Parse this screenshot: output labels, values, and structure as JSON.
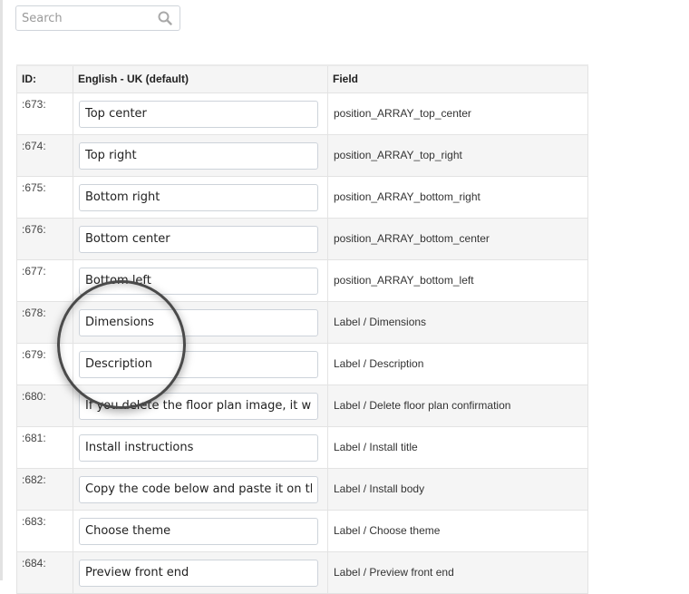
{
  "search": {
    "placeholder": "Search",
    "value": "",
    "icon": "search-icon"
  },
  "table": {
    "headers": {
      "id": "ID:",
      "value": "English - UK (default)",
      "field": "Field"
    },
    "rows": [
      {
        "id": ":673:",
        "value": "Top center",
        "field": "position_ARRAY_top_center"
      },
      {
        "id": ":674:",
        "value": "Top right",
        "field": "position_ARRAY_top_right"
      },
      {
        "id": ":675:",
        "value": "Bottom right",
        "field": "position_ARRAY_bottom_right"
      },
      {
        "id": ":676:",
        "value": "Bottom center",
        "field": "position_ARRAY_bottom_center"
      },
      {
        "id": ":677:",
        "value": "Bottom left",
        "field": "position_ARRAY_bottom_left"
      },
      {
        "id": ":678:",
        "value": "Dimensions",
        "field": "Label / Dimensions"
      },
      {
        "id": ":679:",
        "value": "Description",
        "field": "Label / Description"
      },
      {
        "id": ":680:",
        "value": "If you delete the floor plan image, it will",
        "field": "Label / Delete floor plan confirmation"
      },
      {
        "id": ":681:",
        "value": "Install instructions",
        "field": "Label / Install title"
      },
      {
        "id": ":682:",
        "value": "Copy the code below and paste it on th",
        "field": "Label / Install body"
      },
      {
        "id": ":683:",
        "value": "Choose theme",
        "field": "Label / Choose theme"
      },
      {
        "id": ":684:",
        "value": "Preview front end",
        "field": "Label / Preview front end"
      }
    ]
  }
}
